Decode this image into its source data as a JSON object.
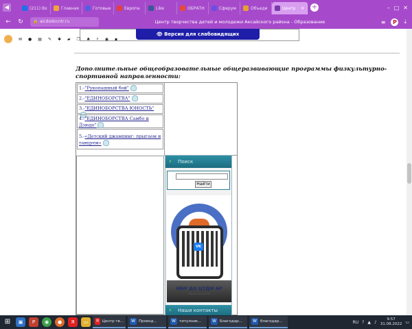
{
  "browser": {
    "tabs": [
      {
        "label": "(211) Вх",
        "color": "#1a73e8"
      },
      {
        "label": "Главная",
        "color": "#f3a33a"
      },
      {
        "label": "Готовые",
        "color": "#5560e0"
      },
      {
        "label": "Европа",
        "color": "#e04040"
      },
      {
        "label": "Like",
        "color": "#3b5998"
      },
      {
        "label": "ОБРАТН",
        "color": "#e84a3a"
      },
      {
        "label": "Сферум",
        "color": "#6b4fe0"
      },
      {
        "label": "Объеди",
        "color": "#e8a030"
      },
      {
        "label": "Центр",
        "color": "#7a3aa8",
        "active": true
      }
    ],
    "new_tab": "+",
    "address": "aicdodocntr.ru",
    "page_title": "Центр творчества детей и молодежи Аксайского района - Образование"
  },
  "page": {
    "vision_button": "Версия для слабовидящих",
    "heading": "Дополнительные общеобразовательные общеразвивающие программы физкультурно-спортивной направленности:",
    "programs": [
      {
        "num": "1.-",
        "label": "\"Рукопашный бой\""
      },
      {
        "num": "2.-",
        "label": "\"ЕДИНОБОРСТВА\""
      },
      {
        "num": "3.-",
        "label": "\"ЕДИНОБОРСТВА ЮНОСТЬ\""
      },
      {
        "num": "4.-",
        "label": "\"ЕДИНОБОРСТВА Самбо и Дзюдо\""
      },
      {
        "num": "5.-",
        "label": "«Детский джампинг: прыгаем и танцуем»"
      }
    ],
    "sidebar": {
      "search_title": "Поиск",
      "search_button": "Найти",
      "poster_title": "МБУ ДО ЦТДМ АР",
      "poster_sub": "город Аксай РО",
      "qr_badge": "VK",
      "contacts_title": "Наши контакты"
    }
  },
  "taskbar": {
    "apps": [
      {
        "label": "Центр тв...",
        "color": "#e02020"
      },
      {
        "label": "Провод...",
        "color": "#1e5ab0"
      },
      {
        "label": "титулник...",
        "color": "#1e5ab0"
      },
      {
        "label": "Благодар...",
        "color": "#1e5ab0"
      },
      {
        "label": "благодар...",
        "color": "#1e5ab0"
      }
    ],
    "lang": "RU",
    "time": "9:57",
    "date": "31.08.2022"
  }
}
